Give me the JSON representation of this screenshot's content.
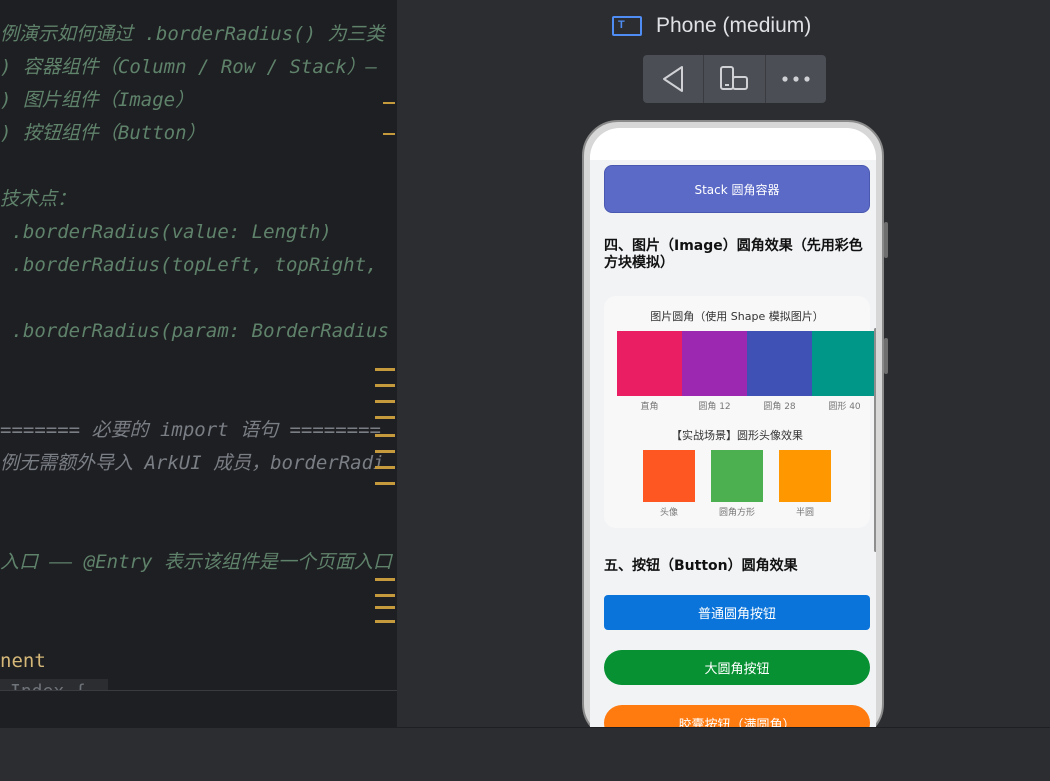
{
  "editor": {
    "lines": [
      {
        "text": "例演示如何通过 .borderRadius() 为三类",
        "style": "c-doc"
      },
      {
        "text": ") 容器组件（Column / Row / Stack）—",
        "style": "c-doc"
      },
      {
        "text": ") 图片组件（Image）",
        "style": "c-doc"
      },
      {
        "text": ") 按钮组件（Button）",
        "style": "c-doc"
      },
      {
        "text": "",
        "style": "c-doc"
      },
      {
        "text": "技术点：",
        "style": "c-doc"
      },
      {
        "text": " .borderRadius(value: Length)",
        "style": "c-doc"
      },
      {
        "text": " .borderRadius(topLeft, topRight,",
        "style": "c-doc"
      },
      {
        "text": "",
        "style": "c-doc"
      },
      {
        "text": " .borderRadius(param: BorderRadius",
        "style": "c-doc"
      },
      {
        "text": "",
        "style": "c-doc"
      },
      {
        "text": "",
        "style": "c-doc"
      },
      {
        "text": "======= 必要的 import 语句 ========",
        "style": "c-comment"
      },
      {
        "text": "例无需额外导入 ArkUI 成员，borderRadi",
        "style": "c-comment"
      },
      {
        "text": "",
        "style": "c-doc"
      },
      {
        "text": "",
        "style": "c-doc"
      },
      {
        "text": "入口 —— @Entry 表示该组件是一个页面入口",
        "style": "c-doc"
      },
      {
        "text": "",
        "style": "c-doc"
      },
      {
        "text": "",
        "style": "c-doc"
      },
      {
        "text": "nent",
        "style": "c-yellow"
      }
    ],
    "sticky_line": "Index {"
  },
  "previewer": {
    "device_icon_letter": "T",
    "device_title": "Phone (medium)",
    "toolbar": [
      "back-icon",
      "rotate-device-icon",
      "more-icon"
    ]
  },
  "app": {
    "stack_label": "Stack 圆角容器",
    "image_section_title": "四、图片（Image）圆角效果（先用彩色方块模拟）",
    "image_card_title": "图片圆角（使用 Shape 模拟图片）",
    "swatches": [
      {
        "label": "直角",
        "color": "#e91e63"
      },
      {
        "label": "圆角 12",
        "color": "#9c27b0"
      },
      {
        "label": "圆角 28",
        "color": "#3f51b5"
      },
      {
        "label": "圆形 40",
        "color": "#009688"
      }
    ],
    "avatar_title": "【实战场景】圆形头像效果",
    "avatars": [
      {
        "label": "头像",
        "color": "#ff5722"
      },
      {
        "label": "圆角方形",
        "color": "#4caf50"
      },
      {
        "label": "半圆",
        "color": "#ff9800"
      }
    ],
    "button_section_title": "五、按钮（Button）圆角效果",
    "buttons": [
      {
        "label": "普通圆角按钮",
        "color": "#0a74da"
      },
      {
        "label": "大圆角按钮",
        "color": "#079133"
      },
      {
        "label": "胶囊按钮（满圆角）",
        "color": "#ff7a0f"
      }
    ]
  }
}
